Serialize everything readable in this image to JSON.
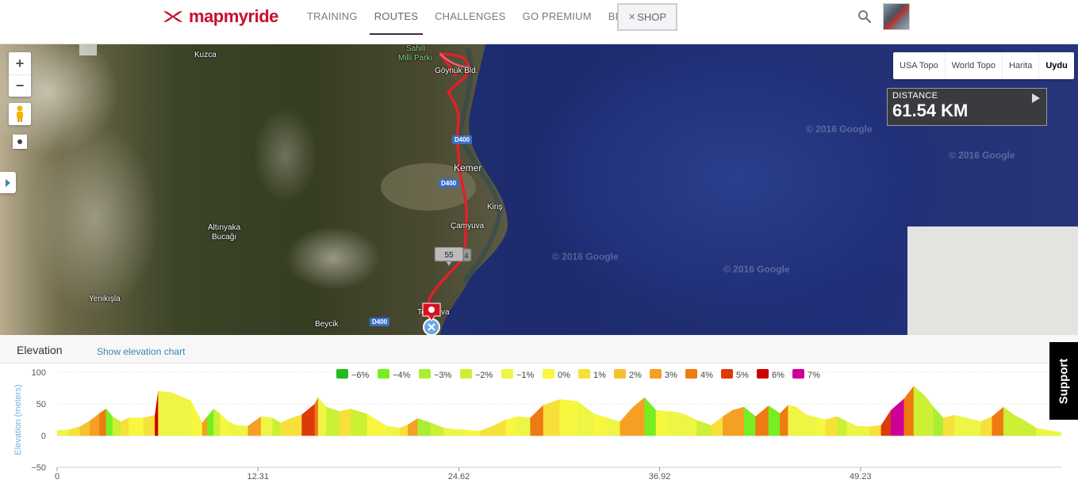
{
  "header": {
    "logo_text": "mapmyride",
    "nav": [
      {
        "label": "TRAINING",
        "active": false
      },
      {
        "label": "ROUTES",
        "active": true
      },
      {
        "label": "CHALLENGES",
        "active": false
      },
      {
        "label": "GO PREMIUM",
        "active": false
      },
      {
        "label": "BLOG",
        "active": false
      }
    ],
    "shop_label": "SHOP"
  },
  "map": {
    "zoom_in": "+",
    "zoom_out": "−",
    "map_types": [
      "USA Topo",
      "World Topo",
      "Harita",
      "Uydu"
    ],
    "active_type": "Uydu",
    "distance_label": "DISTANCE",
    "distance_value": "61.54 KM",
    "watermark": "© 2016 Google",
    "labels": {
      "kuzca": "Kuzca",
      "sahili": "Sahili",
      "milli_parki": "Milli Parkı",
      "goynuk": "Göynük Bld.",
      "kemer": "Kemer",
      "kiris": "Kiriş",
      "camyuva": "Çamyuva",
      "altinyaka": "Altınyaka",
      "bucagi": "Bucağı",
      "yenikisla": "Yenikışla",
      "beycik": "Beycik",
      "tekirova": "Te",
      "tekirova_end": "va"
    },
    "roads": [
      "D400",
      "D400",
      "D400"
    ],
    "marker_number": "55",
    "marker_suffix": "4"
  },
  "elevation": {
    "title": "Elevation",
    "link": "Show elevation chart",
    "support": "Support"
  },
  "colors": {
    "brand_red": "#c8102e",
    "route_red": "#e0202a",
    "grade": {
      "-6%": "#22bb22",
      "-4%": "#77ee22",
      "-3%": "#aaee33",
      "-2%": "#ccf033",
      "-1%": "#eef544",
      "0%": "#f7f740",
      "1%": "#f7e03a",
      "2%": "#f7c030",
      "3%": "#f5a024",
      "4%": "#ee7a12",
      "5%": "#dd3a0a",
      "6%": "#cc0000",
      "7%": "#cc0099"
    }
  },
  "chart_data": {
    "type": "area",
    "ylabel": "Elevation (meters)",
    "xlabel": "",
    "ylim": [
      -50,
      100
    ],
    "yticks": [
      100,
      50,
      0,
      -50
    ],
    "xlim": [
      0,
      61.54
    ],
    "xticks": [
      "0",
      "12.31",
      "24.62",
      "36.92",
      "49.23"
    ],
    "xtick_values": [
      0,
      12.31,
      24.62,
      36.92,
      49.23
    ],
    "legend": [
      "-6%",
      "-4%",
      "-3%",
      "-2%",
      "-1%",
      "0%",
      "1%",
      "2%",
      "3%",
      "4%",
      "5%",
      "6%",
      "7%"
    ],
    "legend_position": "top-center",
    "grid": true,
    "x": [
      0,
      0.7,
      1.4,
      2.0,
      2.6,
      3.0,
      3.4,
      3.9,
      4.4,
      5.3,
      6.0,
      6.2,
      7.0,
      8.2,
      8.9,
      9.2,
      9.6,
      10.0,
      10.5,
      11.0,
      11.7,
      12.5,
      13.2,
      13.7,
      14.3,
      15.0,
      15.8,
      16.0,
      16.5,
      17.3,
      18.0,
      19.0,
      20.2,
      21.0,
      21.5,
      22.1,
      22.9,
      23.7,
      24.3,
      25.0,
      25.9,
      26.7,
      27.5,
      28.2,
      29.0,
      29.8,
      30.8,
      31.9,
      32.9,
      33.7,
      34.5,
      35.3,
      36.0,
      36.7,
      37.4,
      37.9,
      38.5,
      39.2,
      40.1,
      40.8,
      41.4,
      42.1,
      42.8,
      43.6,
      44.3,
      44.8,
      45.3,
      45.9,
      46.6,
      47.1,
      47.8,
      48.4,
      49.0,
      49.8,
      50.5,
      51.1,
      51.9,
      52.5,
      53.2,
      53.7,
      54.3,
      55.0,
      55.7,
      56.6,
      57.3,
      58.0,
      58.6,
      59.2,
      60.0,
      60.8,
      61.54
    ],
    "y": [
      8,
      9,
      14,
      23,
      35,
      42,
      30,
      22,
      28,
      28,
      32,
      70,
      68,
      55,
      20,
      30,
      42,
      34,
      22,
      16,
      15,
      30,
      28,
      20,
      27,
      33,
      50,
      60,
      45,
      38,
      42,
      34,
      15,
      12,
      17,
      27,
      20,
      12,
      10,
      9,
      7,
      15,
      25,
      30,
      28,
      48,
      57,
      54,
      34,
      28,
      22,
      45,
      60,
      40,
      38,
      37,
      33,
      24,
      16,
      30,
      40,
      45,
      30,
      47,
      35,
      48,
      45,
      33,
      28,
      25,
      30,
      22,
      15,
      14,
      16,
      40,
      58,
      78,
      62,
      45,
      28,
      32,
      28,
      22,
      30,
      45,
      33,
      25,
      12,
      8,
      5
    ],
    "grades": [
      "-1%",
      "1%",
      "2%",
      "3%",
      "4%",
      "-4%",
      "-2%",
      "1%",
      "0%",
      "1%",
      "6%",
      "-1%",
      "-1%",
      "0%",
      "3%",
      "-4%",
      "-2%",
      "0%",
      "-1%",
      "-1%",
      "3%",
      "-1%",
      "-2%",
      "1%",
      "1%",
      "5%",
      "4%",
      "-1%",
      "-2%",
      "1%",
      "-2%",
      "0%",
      "-1%",
      "1%",
      "3%",
      "-3%",
      "-2%",
      "-1%",
      "-1%",
      "0%",
      "1%",
      "1%",
      "0%",
      "-1%",
      "4%",
      "1%",
      "0%",
      "-1%",
      "0%",
      "-1%",
      "3%",
      "3%",
      "-4%",
      "0%",
      "-1%",
      "-1%",
      "-1%",
      "-2%",
      "1%",
      "3%",
      "3%",
      "-4%",
      "4%",
      "-4%",
      "4%",
      "-1%",
      "-1%",
      "-1%",
      "0%",
      "1%",
      "-2%",
      "-1%",
      "-1%",
      "1%",
      "5%",
      "7%",
      "4%",
      "-2%",
      "-2%",
      "-3%",
      "1%",
      "-1%",
      "-1%",
      "1%",
      "4%",
      "-2%",
      "-2%",
      "-2%",
      "-1%",
      "-1%"
    ]
  }
}
